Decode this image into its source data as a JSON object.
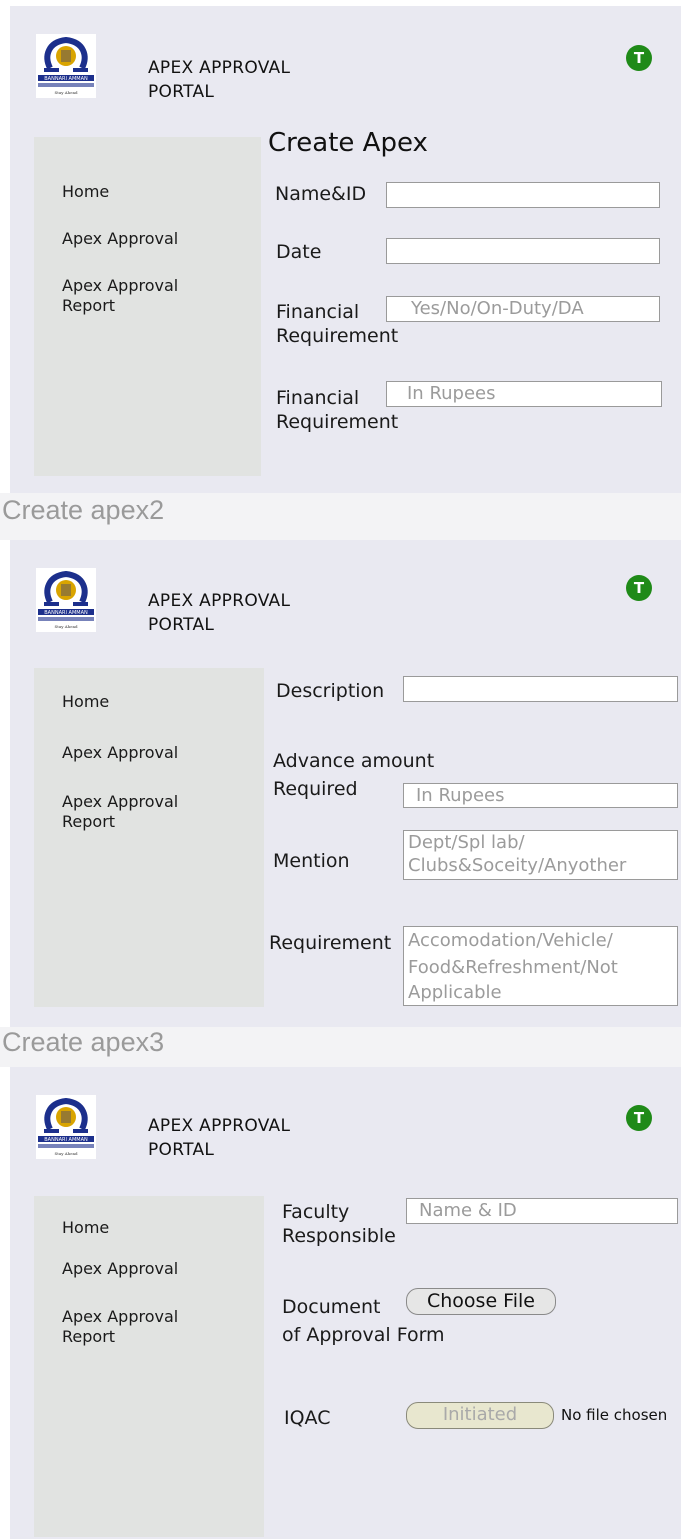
{
  "brand": {
    "line1": "APEX APPROVAL",
    "line2": "PORTAL",
    "avatar_initial": "T"
  },
  "logo": {
    "brand_text": "BANNARI AMMAN",
    "sub_text": "INSTITUTE OF TECHNOLOGY",
    "tagline": "Stay Ahead"
  },
  "nav": {
    "home": "Home",
    "apex_approval": "Apex Approval",
    "report_line1": "Apex Approval",
    "report_line2": "Report"
  },
  "screen1": {
    "title": "Create Apex",
    "name_id_label": "Name&ID",
    "date_label": "Date",
    "fin1_line1": "Financial",
    "fin1_line2": "Requirement",
    "fin1_placeholder": "Yes/No/On-Duty/DA",
    "fin2_line1": "Financial",
    "fin2_line2": "Requirement",
    "fin2_placeholder": "In Rupees"
  },
  "section_labels": {
    "apex2": "Create apex2",
    "apex3": "Create apex3"
  },
  "screen2": {
    "description_label": "Description",
    "advance_line1": "Advance amount",
    "advance_line2": "Required",
    "advance_placeholder": "In Rupees",
    "mention_label": "Mention",
    "mention_placeholder_1": "Dept/Spl lab/",
    "mention_placeholder_2": "Clubs&Soceity/Anyother",
    "requirement_label": "Requirement",
    "requirement_placeholder_1": "Accomodation/Vehicle/",
    "requirement_placeholder_2": "Food&Refreshment/Not",
    "requirement_placeholder_3": "Applicable"
  },
  "screen3": {
    "faculty_line1": "Faculty",
    "faculty_line2": "Responsible",
    "faculty_placeholder": "Name & ID",
    "doc_line1": "Document",
    "doc_line2": "of Approval Form",
    "choose_file": "Choose File",
    "iqac_label": "IQAC",
    "initiated": "Initiated",
    "no_file": "No file chosen"
  },
  "colors": {
    "panel_bg": "#e9e9f1",
    "sidebar_bg": "#e1e3e1",
    "avatar_bg": "#1f8a18",
    "logo_blue": "#1c2f8c",
    "logo_gold": "#d9a400"
  }
}
